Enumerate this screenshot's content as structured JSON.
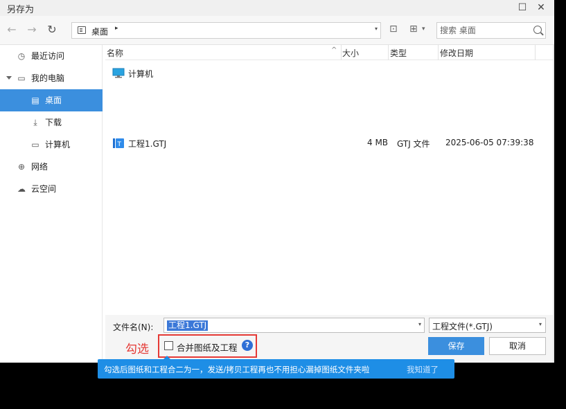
{
  "window": {
    "title": "另存为",
    "maximize_glyph": "☐",
    "close_glyph": "✕"
  },
  "toolbar": {
    "back_glyph": "←",
    "forward_glyph": "→",
    "refresh_glyph": "↻",
    "path_current": "桌面",
    "path_arrow": "▸",
    "path_dropdown": "▾",
    "new_folder_glyph": "⊡",
    "view_glyph": "⊞",
    "view_dropdown": "▾",
    "search_placeholder": "搜索 桌面"
  },
  "sidebar": {
    "items": [
      {
        "label": "最近访问",
        "icon": "clock-icon",
        "glyph": "◷"
      },
      {
        "label": "我的电脑",
        "icon": "monitor-icon",
        "glyph": "▭"
      },
      {
        "label": "桌面",
        "icon": "desktop-icon",
        "glyph": "▤",
        "active": true
      },
      {
        "label": "下载",
        "icon": "download-icon",
        "glyph": "⤓"
      },
      {
        "label": "计算机",
        "icon": "computer-icon",
        "glyph": "▭"
      },
      {
        "label": "网络",
        "icon": "globe-icon",
        "glyph": "⊕"
      },
      {
        "label": "云空间",
        "icon": "cloud-icon",
        "glyph": "☁"
      }
    ]
  },
  "file_list": {
    "columns": {
      "name": "名称",
      "size": "大小",
      "type": "类型",
      "modified": "修改日期"
    },
    "sort_glyph": "^",
    "rows": [
      {
        "name": "计算机",
        "icon": "computer-icon",
        "size": "",
        "type": "",
        "modified": ""
      },
      {
        "name": "工程1.GTJ",
        "icon": "gtj-file-icon",
        "size": "4 MB",
        "type": "GTJ 文件",
        "modified": "2025-06-05 07:39:38"
      }
    ]
  },
  "bottom": {
    "filename_label": "文件名(N):",
    "filename_value": "工程1.GTJ",
    "filetype_value": "工程文件(*.GTJ)",
    "dropdown_glyph": "▾",
    "merge_checkbox_label": "合并图纸及工程",
    "merge_checked": false,
    "help_glyph": "?",
    "save_label": "保存",
    "cancel_label": "取消"
  },
  "annotation": {
    "text": "勾选",
    "color": "#e53935"
  },
  "tooltip": {
    "message": "勾选后图纸和工程合二为一，发送/拷贝工程再也不用担心漏掉图纸文件夹啦",
    "dismiss": "我知道了"
  },
  "colors": {
    "accent": "#3b8fde",
    "tooltip_bg": "#1e8ee6",
    "annotation_red": "#e53935"
  }
}
